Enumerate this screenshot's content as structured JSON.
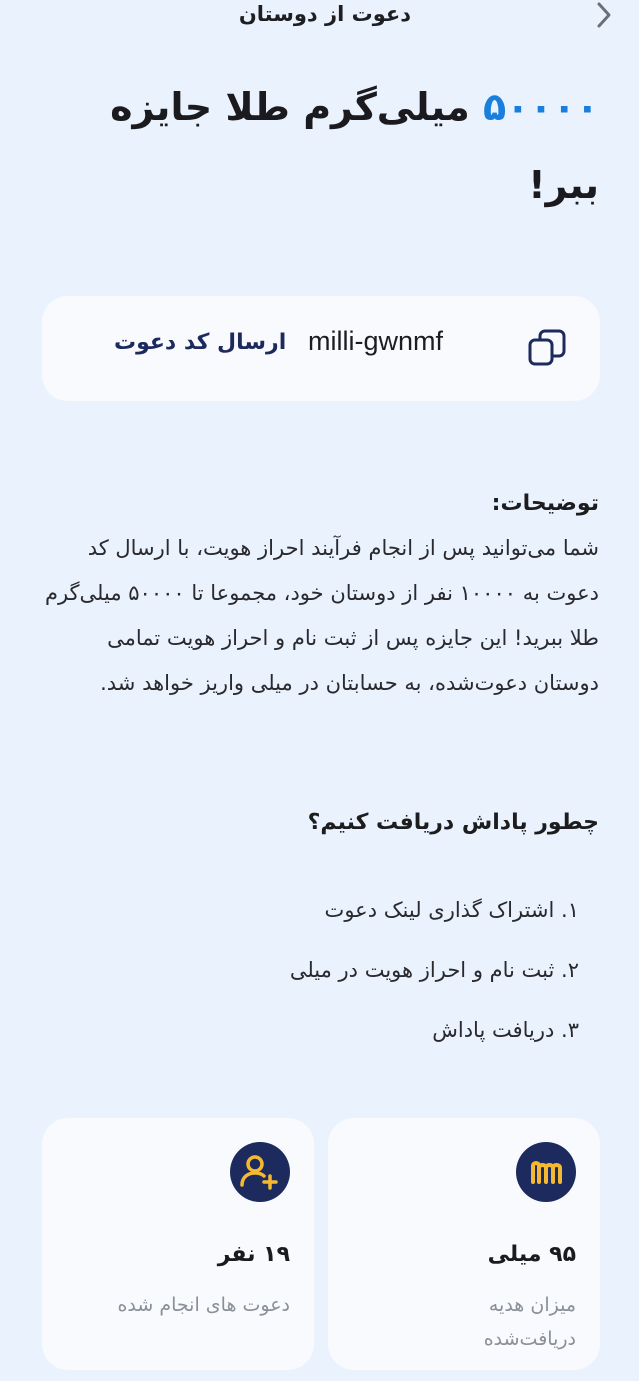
{
  "header": {
    "title": "دعوت از دوستان",
    "back_icon": "chevron-right-icon"
  },
  "hero": {
    "amount": "۵۰۰۰۰",
    "text": " میلی‌گرم طلا جایزه ببر!"
  },
  "invite": {
    "copy_icon": "copy-icon",
    "code": "milli-gwnmf",
    "send_label": "ارسال کد دعوت"
  },
  "description": {
    "heading": "توضیحات:",
    "body": "شما می‌توانید پس از انجام فرآیند احراز هویت، با ارسال کد دعوت به ۱۰۰۰۰ نفر از دوستان خود، مجموعا تا ۵۰۰۰۰ میلی‌گرم طلا ببرید! این جایزه پس از ثبت نام و احراز هویت تمامی دوستان دعوت‌شده، به حسابتان در میلی واریز خواهد شد."
  },
  "how": {
    "heading": "چطور پاداش دریافت کنیم؟",
    "steps": [
      "۱. اشتراک گذاری لینک دعوت",
      "۲. ثبت نام و احراز هویت در میلی",
      "۳. دریافت پاداش"
    ]
  },
  "stats": {
    "gift": {
      "icon": "milli-logo-icon",
      "value": "۹۵ میلی",
      "label": "میزان هدیه دریافت‌شده"
    },
    "invites": {
      "icon": "add-user-icon",
      "value": "۱۹ نفر",
      "label": "دعوت های انجام شده"
    }
  },
  "colors": {
    "background": "#eaf2fd",
    "accent": "#1a7fdc",
    "navy": "#1c2a5e",
    "gold": "#f5b931",
    "card": "#f8fafd"
  }
}
